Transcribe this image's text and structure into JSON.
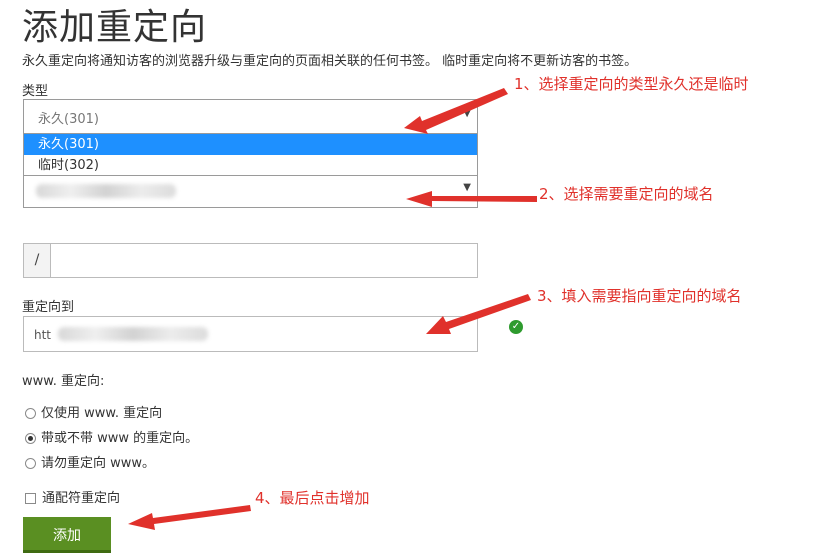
{
  "page": {
    "title": "添加重定向",
    "description": "永久重定向将通知访客的浏览器升级与重定向的页面相关联的任何书签。 临时重定向将不更新访客的书签。"
  },
  "type_field": {
    "label": "类型",
    "selected": "永久(301)",
    "options": [
      "永久(301)",
      "临时(302)"
    ]
  },
  "domain_field": {
    "selected": ""
  },
  "path_field": {
    "prefix": "/",
    "value": ""
  },
  "redirect_to": {
    "label": "重定向到",
    "value_visible": "htt"
  },
  "www_redirect": {
    "label": "www. 重定向:",
    "options": [
      "仅使用 www. 重定向",
      "带或不带 www 的重定向。",
      "请勿重定向 www。"
    ],
    "selected_index": 1
  },
  "wildcard": {
    "label": "通配符重定向",
    "checked": false
  },
  "submit": {
    "label": "添加"
  },
  "annotations": [
    "1、选择重定向的类型永久还是临时",
    "2、选择需要重定向的域名",
    "3、填入需要指向重定向的域名",
    "4、最后点击增加"
  ],
  "colors": {
    "accent_button": "#5a8f22",
    "selection_highlight": "#1e90ff",
    "annotation": "#e0312b",
    "valid_check": "#2e9b2e"
  }
}
